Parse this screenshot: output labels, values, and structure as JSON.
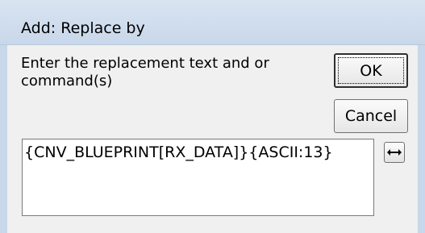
{
  "dialog": {
    "title": "Add: Replace by",
    "prompt": "Enter the replacement text and or command(s)",
    "ok_label": "OK",
    "cancel_label": "Cancel",
    "replacement_value": "{CNV_BLUEPRINT[RX_DATA]}{ASCII:13}",
    "expand_icon": "double-arrow-horizontal-icon"
  }
}
